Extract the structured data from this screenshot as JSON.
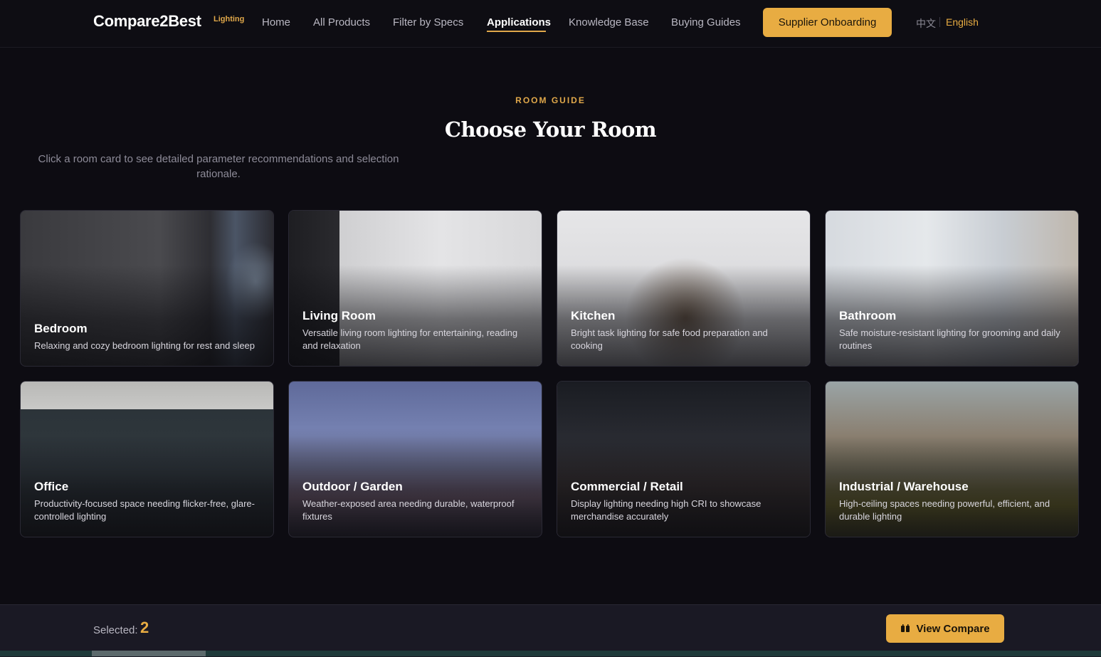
{
  "nav": {
    "brand": "Compare2Best",
    "brand_tag": "Lighting",
    "links": [
      "Home",
      "All Products",
      "Filter by Specs",
      "Applications",
      "Knowledge Base",
      "Buying Guides"
    ],
    "active_link": "Applications",
    "cta": "Supplier Onboarding",
    "lang_zh": "中文",
    "lang_en": "English"
  },
  "hero": {
    "eyebrow": "ROOM GUIDE",
    "title": "Choose Your Room",
    "subtitle": "Click a room card to see detailed parameter recommendations and selection rationale."
  },
  "rooms": [
    {
      "title": "Bedroom",
      "desc": "Relaxing and cozy bedroom lighting for rest and sleep"
    },
    {
      "title": "Living Room",
      "desc": "Versatile living room lighting for entertaining, reading and relaxation"
    },
    {
      "title": "Kitchen",
      "desc": "Bright task lighting for safe food preparation and cooking"
    },
    {
      "title": "Bathroom",
      "desc": "Safe moisture-resistant lighting for grooming and daily routines"
    },
    {
      "title": "Office",
      "desc": "Productivity-focused space needing flicker-free, glare-controlled lighting"
    },
    {
      "title": "Outdoor / Garden",
      "desc": "Weather-exposed area needing durable, waterproof fixtures"
    },
    {
      "title": "Commercial / Retail",
      "desc": "Display lighting needing high CRI to showcase merchandise accurately"
    },
    {
      "title": "Industrial / Warehouse",
      "desc": "High-ceiling spaces needing powerful, efficient, and durable lighting"
    }
  ],
  "compare": {
    "selected_label": "Selected:",
    "selected_count": "2",
    "button": "View Compare",
    "button_icon": "compare-icon"
  },
  "colors": {
    "accent": "#e8ac42",
    "background": "#0d0c12"
  }
}
